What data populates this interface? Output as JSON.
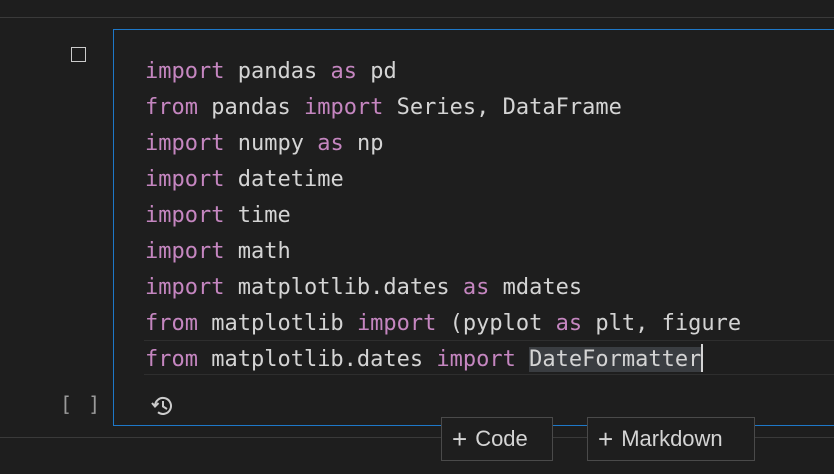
{
  "notebook": {
    "cell": {
      "execution_count_label": "[ ]",
      "lines": [
        [
          {
            "t": "import",
            "k": true
          },
          {
            "t": " pandas ",
            "k": false
          },
          {
            "t": "as",
            "k": true
          },
          {
            "t": " pd",
            "k": false
          }
        ],
        [
          {
            "t": "from",
            "k": true
          },
          {
            "t": " pandas ",
            "k": false
          },
          {
            "t": "import",
            "k": true
          },
          {
            "t": " Series, DataFrame",
            "k": false
          }
        ],
        [
          {
            "t": "import",
            "k": true
          },
          {
            "t": " numpy ",
            "k": false
          },
          {
            "t": "as",
            "k": true
          },
          {
            "t": " np",
            "k": false
          }
        ],
        [
          {
            "t": "import",
            "k": true
          },
          {
            "t": " datetime",
            "k": false
          }
        ],
        [
          {
            "t": "import",
            "k": true
          },
          {
            "t": " time",
            "k": false
          }
        ],
        [
          {
            "t": "import",
            "k": true
          },
          {
            "t": " math",
            "k": false
          }
        ],
        [
          {
            "t": "import",
            "k": true
          },
          {
            "t": " matplotlib.dates ",
            "k": false
          },
          {
            "t": "as",
            "k": true
          },
          {
            "t": " mdates",
            "k": false
          }
        ],
        [
          {
            "t": "from",
            "k": true
          },
          {
            "t": " matplotlib ",
            "k": false
          },
          {
            "t": "import",
            "k": true
          },
          {
            "t": " (pyplot ",
            "k": false
          },
          {
            "t": "as",
            "k": true
          },
          {
            "t": " plt, figure",
            "k": false
          }
        ],
        [
          {
            "t": "from",
            "k": true
          },
          {
            "t": " matplotlib.dates ",
            "k": false
          },
          {
            "t": "import",
            "k": true
          },
          {
            "t": " ",
            "k": false
          },
          {
            "t": "DateFormatter",
            "k": false,
            "sel": true
          }
        ]
      ]
    },
    "actions": {
      "add_code_label": "Code",
      "add_markdown_label": "Markdown"
    }
  },
  "colors": {
    "keyword": "#c586c0",
    "text": "#d4d4d4",
    "focus_border": "#1e78c8",
    "background": "#1e1e1e"
  },
  "icons": {
    "checkbox": "checkbox-icon",
    "history": "history-icon",
    "plus": "plus-icon"
  }
}
